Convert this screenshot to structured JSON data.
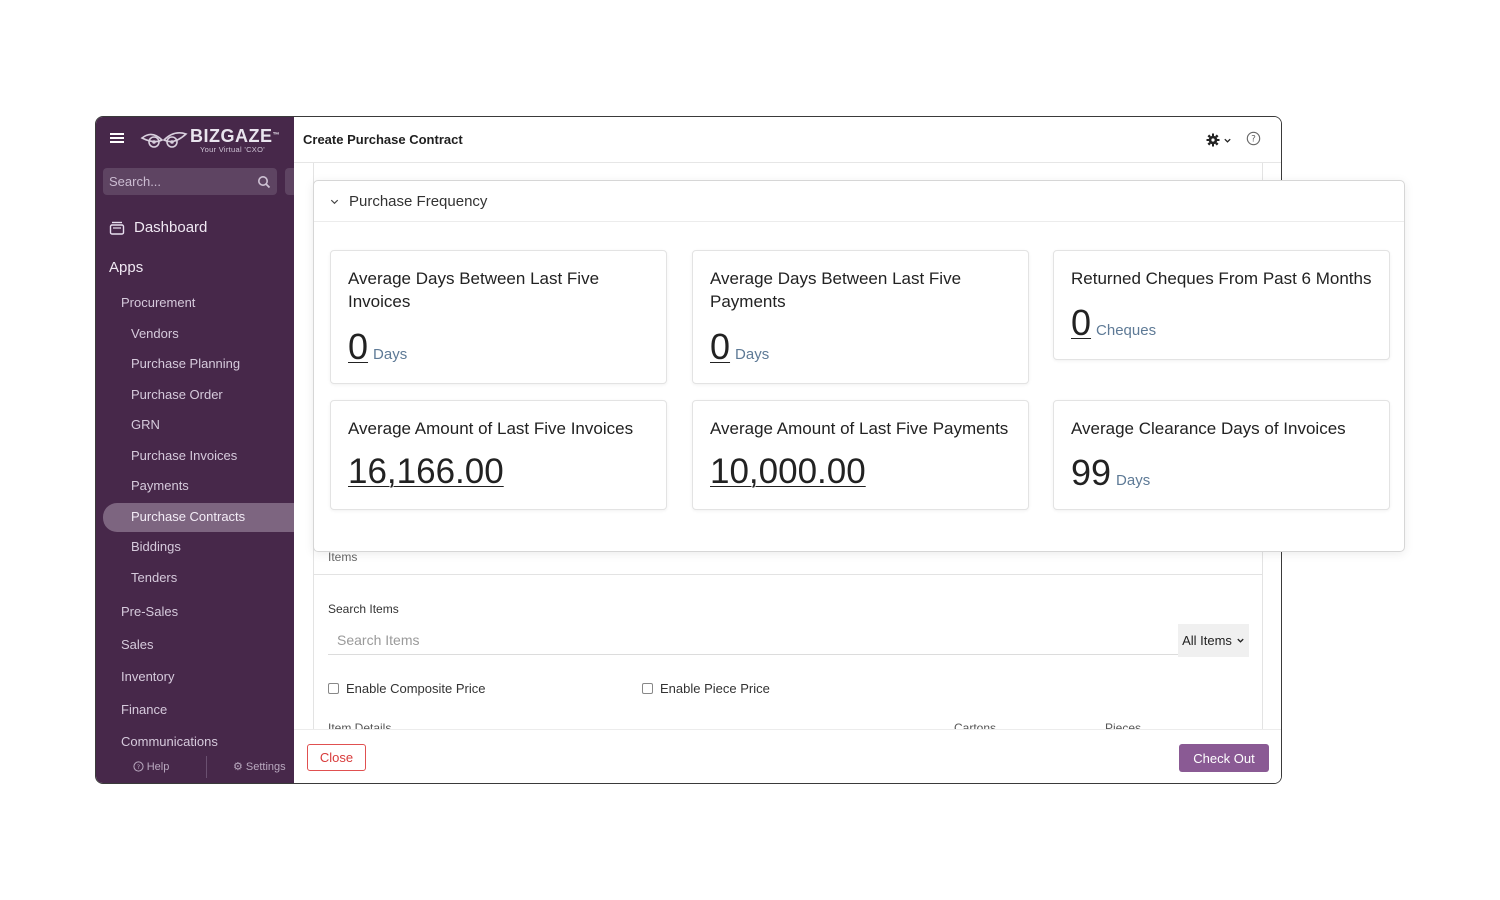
{
  "sidebar": {
    "logo": {
      "name": "BIZGAZE",
      "tm": "™",
      "tagline": "Your Virtual 'CXO'"
    },
    "search_placeholder": "Search...",
    "dashboard_label": "Dashboard",
    "apps_label": "Apps",
    "procurement_label": "Procurement",
    "procurement_items": [
      {
        "label": "Vendors"
      },
      {
        "label": "Purchase Planning"
      },
      {
        "label": "Purchase Order"
      },
      {
        "label": "GRN"
      },
      {
        "label": "Purchase Invoices"
      },
      {
        "label": "Payments"
      },
      {
        "label": "Purchase Contracts",
        "active": true
      },
      {
        "label": "Biddings"
      },
      {
        "label": "Tenders"
      }
    ],
    "modules": [
      {
        "label": "Pre-Sales"
      },
      {
        "label": "Sales"
      },
      {
        "label": "Inventory"
      },
      {
        "label": "Finance"
      },
      {
        "label": "Communications"
      }
    ],
    "footer": {
      "help_label": "Help",
      "settings_label": "Settings"
    }
  },
  "main": {
    "title": "Create Purchase Contract",
    "items_label": "Items",
    "search_items_label": "Search Items",
    "search_items_placeholder": "Search Items",
    "filter_value": "All Items",
    "enable_composite_label": "Enable Composite Price",
    "enable_piece_label": "Enable Piece Price",
    "cut_labels": [
      "Item Details",
      "Cartons",
      "Pieces"
    ],
    "close_label": "Close",
    "checkout_label": "Check Out"
  },
  "popup": {
    "title": "Purchase Frequency",
    "cards": [
      {
        "title": "Average Days Between Last Five Invoices",
        "value": "0",
        "unit": "Days"
      },
      {
        "title": "Average Days Between Last Five Payments",
        "value": "0",
        "unit": "Days"
      },
      {
        "title": "Returned Cheques From Past 6 Months",
        "value": "0",
        "unit": "Cheques"
      },
      {
        "title": "Average Amount of Last Five Invoices",
        "value": "16,166.00",
        "unit": ""
      },
      {
        "title": "Average Amount of Last Five Payments",
        "value": "10,000.00",
        "unit": ""
      },
      {
        "title": "Average Clearance Days of Invoices",
        "value": "99",
        "unit": "Days"
      }
    ]
  },
  "colors": {
    "sidebar_bg": "#47284a",
    "active_item_bg": "#7d6580",
    "accent": "#8a5a94",
    "close_red": "#d83b3b",
    "unit_text": "#5e7a96"
  }
}
